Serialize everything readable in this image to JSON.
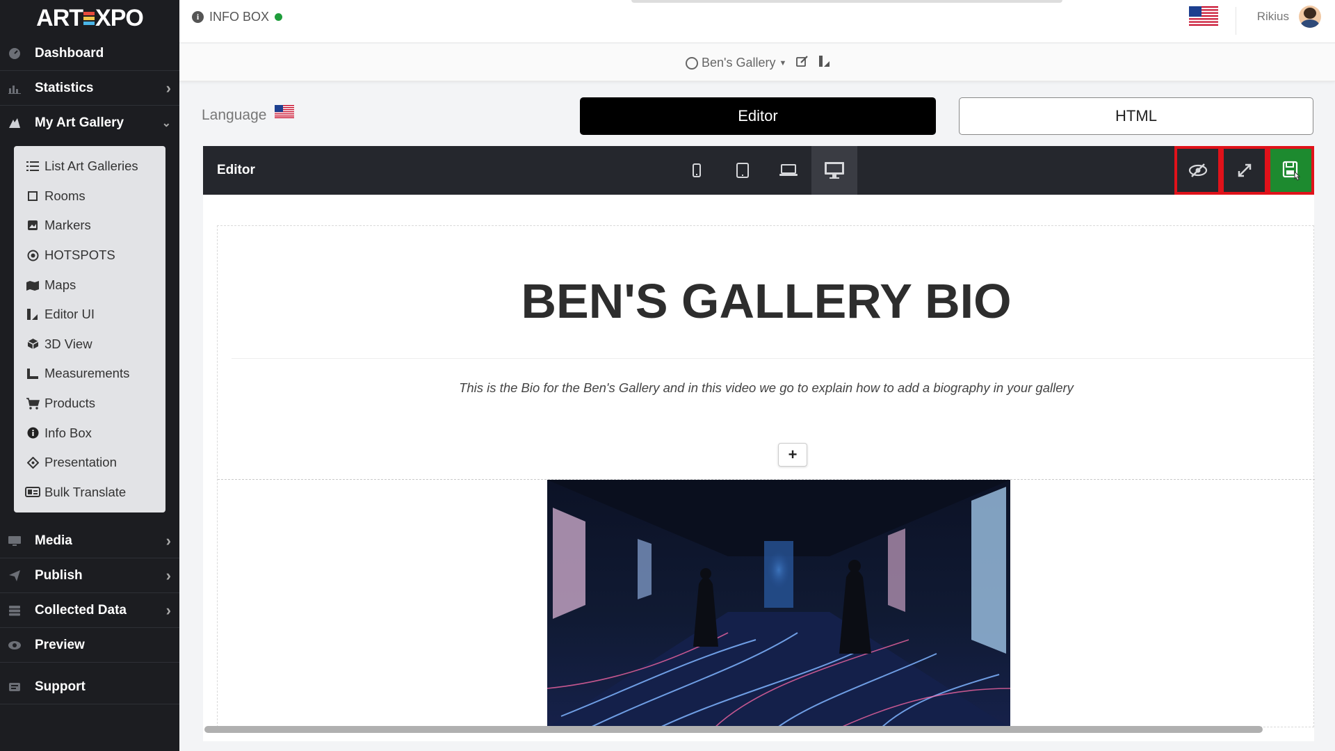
{
  "brand": {
    "logo_left": "ART",
    "logo_right": "XPO",
    "logo_mark_colors": [
      "#e84b3c",
      "#f2c84b",
      "#4bb6e8"
    ]
  },
  "sidebar": {
    "items_top": [
      {
        "label": "Dashboard",
        "icon": "dashboard-icon"
      },
      {
        "label": "Statistics",
        "icon": "bar-chart-icon",
        "chevron": ">"
      },
      {
        "label": "My Art Gallery",
        "icon": "art-gallery-icon",
        "chevron": "v"
      }
    ],
    "submenu": [
      {
        "label": "List Art Galleries",
        "icon": "list-icon"
      },
      {
        "label": "Rooms",
        "icon": "rooms-icon"
      },
      {
        "label": "Markers",
        "icon": "marker-icon"
      },
      {
        "label": "HOTSPOTS",
        "icon": "hotspot-icon"
      },
      {
        "label": "Maps",
        "icon": "map-icon"
      },
      {
        "label": "Editor UI",
        "icon": "editor-ui-icon"
      },
      {
        "label": "3D View",
        "icon": "cube-icon"
      },
      {
        "label": "Measurements",
        "icon": "ruler-icon"
      },
      {
        "label": "Products",
        "icon": "cart-icon"
      },
      {
        "label": "Info Box",
        "icon": "info-icon"
      },
      {
        "label": "Presentation",
        "icon": "presentation-icon"
      },
      {
        "label": "Bulk Translate",
        "icon": "translate-icon"
      }
    ],
    "items_bottom": [
      {
        "label": "Media",
        "icon": "media-icon",
        "chevron": ">"
      },
      {
        "label": "Publish",
        "icon": "publish-icon",
        "chevron": ">"
      },
      {
        "label": "Collected Data",
        "icon": "database-icon",
        "chevron": ">"
      },
      {
        "label": "Preview",
        "icon": "eye-icon"
      },
      {
        "label": "Support",
        "icon": "support-icon"
      }
    ]
  },
  "topbar": {
    "page_label": "INFO BOX",
    "status_color": "#1f9d3b",
    "user_name": "Rikius",
    "flag": "us-flag-icon"
  },
  "gallery_bar": {
    "gallery_name": "Ben's Gallery"
  },
  "language": {
    "label": "Language",
    "flag": "us-flag-icon"
  },
  "tabs": {
    "editor": "Editor",
    "html": "HTML",
    "active": "editor"
  },
  "editor": {
    "toolbar_title": "Editor",
    "devices": [
      "mobile-icon",
      "tablet-icon",
      "laptop-icon",
      "desktop-icon"
    ],
    "active_device": "desktop-icon",
    "actions": [
      "hide-preview-icon",
      "fullscreen-icon",
      "save-icon"
    ],
    "highlight_color": "#e0121a",
    "save_color": "#1d8a2f"
  },
  "content": {
    "title": "BEN'S GALLERY BIO",
    "body": "This is the Bio for the Ben's Gallery and in this video we go to explain how to add a biography in your gallery",
    "add_block": "+"
  }
}
